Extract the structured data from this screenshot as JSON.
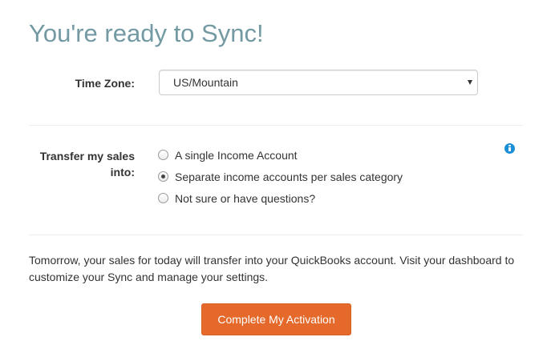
{
  "page": {
    "title": "You're ready to Sync!"
  },
  "timezone": {
    "label": "Time Zone:",
    "value": "US/Mountain"
  },
  "transfer": {
    "label": "Transfer my sales into:",
    "options": [
      {
        "label": "A single Income Account",
        "checked": false
      },
      {
        "label": "Separate income accounts per sales category",
        "checked": true
      },
      {
        "label": "Not sure or have questions?",
        "checked": false
      }
    ],
    "info_icon": "info-icon"
  },
  "footer": {
    "message": "Tomorrow, your sales for today will transfer into your QuickBooks account. Visit your dashboard to customize your Sync and manage your settings."
  },
  "actions": {
    "activate_label": "Complete My Activation"
  },
  "colors": {
    "title": "#7399a3",
    "button": "#e4692a",
    "info_icon": "#1a8fd6",
    "text": "#333333"
  }
}
